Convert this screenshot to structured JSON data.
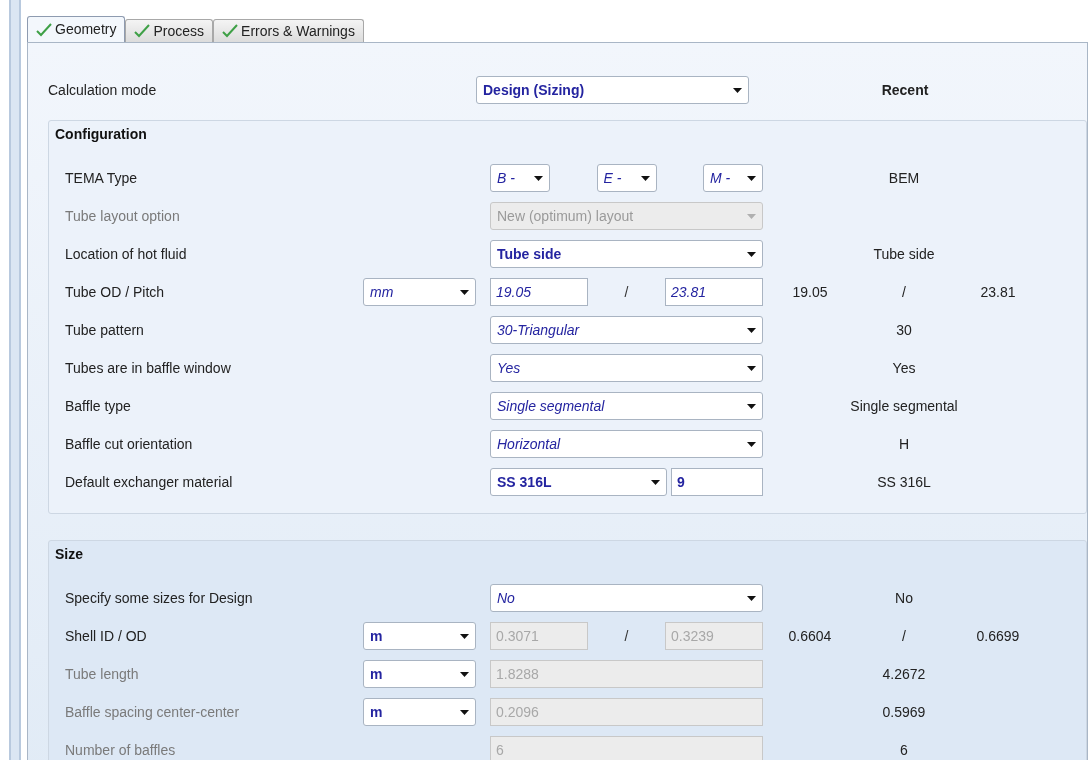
{
  "tabs": [
    {
      "label": "Geometry",
      "selected": true,
      "ok": true
    },
    {
      "label": "Process",
      "selected": false,
      "ok": true
    },
    {
      "label": "Errors & Warnings",
      "selected": false,
      "ok": true
    }
  ],
  "calculation_mode": {
    "label": "Calculation mode",
    "value": "Design (Sizing)",
    "bold": true,
    "italic": false,
    "recent_header": "Recent"
  },
  "groups": [
    {
      "title": "Configuration",
      "shaded": false,
      "rows": [
        {
          "label": "TEMA Type",
          "disabled": false,
          "control": {
            "kind": "triple",
            "values": [
              "B -",
              "E -",
              "M -"
            ],
            "bold": false,
            "italic": true,
            "disabled": false
          },
          "recent": [
            "BEM"
          ]
        },
        {
          "label": "Tube layout option",
          "disabled": true,
          "control": {
            "kind": "select",
            "value": "New (optimum) layout",
            "bold": false,
            "italic": false,
            "disabled": true
          }
        },
        {
          "label": "Location of hot fluid",
          "disabled": false,
          "control": {
            "kind": "select",
            "value": "Tube side",
            "bold": true,
            "italic": false,
            "disabled": false
          },
          "recent": [
            "Tube side"
          ]
        },
        {
          "label": "Tube OD / Pitch",
          "disabled": false,
          "unit": {
            "value": "mm",
            "bold": false,
            "italic": true
          },
          "control": {
            "kind": "pair",
            "values": [
              "19.05",
              "23.81"
            ],
            "separator": "/",
            "bold": false,
            "italic": true,
            "disabled": false
          },
          "recent": [
            "19.05",
            "/",
            "23.81"
          ]
        },
        {
          "label": "Tube pattern",
          "disabled": false,
          "control": {
            "kind": "select",
            "value": "30-Triangular",
            "bold": false,
            "italic": true,
            "disabled": false
          },
          "recent": [
            "30"
          ]
        },
        {
          "label": "Tubes are in baffle window",
          "disabled": false,
          "control": {
            "kind": "select",
            "value": "Yes",
            "bold": false,
            "italic": true,
            "disabled": false
          },
          "recent": [
            "Yes"
          ]
        },
        {
          "label": "Baffle type",
          "disabled": false,
          "control": {
            "kind": "select",
            "value": "Single segmental",
            "bold": false,
            "italic": true,
            "disabled": false
          },
          "recent": [
            "Single segmental"
          ]
        },
        {
          "label": "Baffle cut orientation",
          "disabled": false,
          "control": {
            "kind": "select",
            "value": "Horizontal",
            "bold": false,
            "italic": true,
            "disabled": false
          },
          "recent": [
            "H"
          ]
        },
        {
          "label": "Default exchanger material",
          "disabled": false,
          "control": {
            "kind": "select_input",
            "value": "SS 316L",
            "input": "9",
            "bold": true,
            "italic": false,
            "disabled": false
          },
          "recent": [
            "SS 316L"
          ]
        }
      ]
    },
    {
      "title": "Size",
      "shaded": true,
      "rows": [
        {
          "label": "Specify some sizes for Design",
          "disabled": false,
          "control": {
            "kind": "select",
            "value": "No",
            "bold": false,
            "italic": true,
            "disabled": false
          },
          "recent": [
            "No"
          ]
        },
        {
          "label": "Shell ID / OD",
          "disabled": false,
          "unit": {
            "value": "m",
            "bold": true,
            "italic": false
          },
          "control": {
            "kind": "pair",
            "values": [
              "0.3071",
              "0.3239"
            ],
            "separator": "/",
            "bold": false,
            "italic": false,
            "disabled": true
          },
          "recent": [
            "0.6604",
            "/",
            "0.6699"
          ]
        },
        {
          "label": "Tube length",
          "disabled": true,
          "unit": {
            "value": "m",
            "bold": true,
            "italic": false
          },
          "control": {
            "kind": "input",
            "value": "1.8288",
            "bold": false,
            "italic": false,
            "disabled": true
          },
          "recent": [
            "4.2672"
          ]
        },
        {
          "label": "Baffle spacing center-center",
          "disabled": true,
          "unit": {
            "value": "m",
            "bold": true,
            "italic": false
          },
          "control": {
            "kind": "input",
            "value": "0.2096",
            "bold": false,
            "italic": false,
            "disabled": true
          },
          "recent": [
            "0.5969"
          ]
        },
        {
          "label": "Number of baffles",
          "disabled": true,
          "control": {
            "kind": "input",
            "value": "6",
            "bold": false,
            "italic": false,
            "disabled": true
          },
          "recent": [
            "6"
          ]
        }
      ]
    }
  ]
}
